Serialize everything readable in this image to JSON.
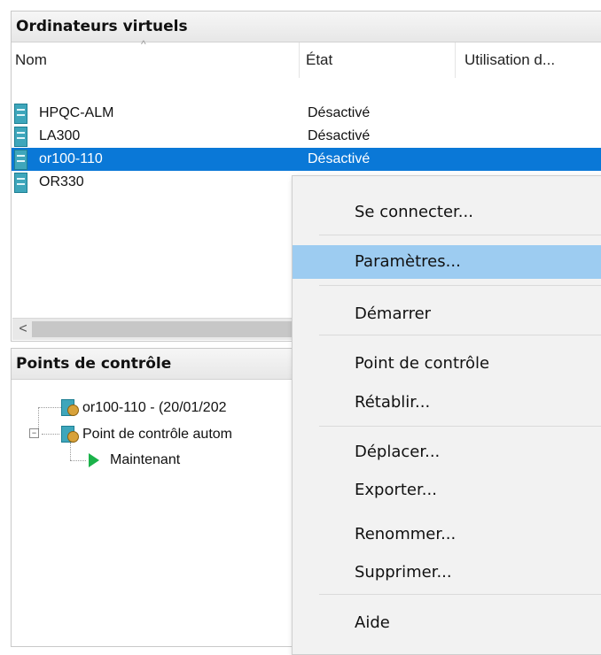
{
  "vm_panel": {
    "title": "Ordinateurs virtuels",
    "columns": [
      "Nom",
      "État",
      "Utilisation d..."
    ],
    "rows": [
      {
        "name": "HPQC-ALM",
        "state": "Désactivé"
      },
      {
        "name": "LA300",
        "state": "Désactivé"
      },
      {
        "name": "or100-110",
        "state": "Désactivé"
      },
      {
        "name": "OR330",
        "state": ""
      }
    ],
    "scroll_left": "<"
  },
  "checkpoints_panel": {
    "title": "Points de contrôle",
    "tree": [
      {
        "label": "or100-110 - (20/01/202"
      },
      {
        "label": "Point de contrôle autom"
      },
      {
        "label": "Maintenant"
      }
    ],
    "expander": "−"
  },
  "context_menu": {
    "items": [
      "Se connecter...",
      "Paramètres...",
      "Démarrer",
      "Point de contrôle",
      "Rétablir...",
      "Déplacer...",
      "Exporter...",
      "Renommer...",
      "Supprimer...",
      "Aide"
    ],
    "highlighted": "Paramètres..."
  },
  "colors": {
    "selection": "#0a78d7",
    "menu_highlight": "#9dccf1",
    "vm_icon": "#3ea6bb",
    "play_icon": "#1bb24a"
  },
  "icons": {
    "vm": "vm-icon",
    "checkpoint": "checkpoint-icon",
    "running": "play-icon",
    "sort": "sort-up-icon"
  }
}
